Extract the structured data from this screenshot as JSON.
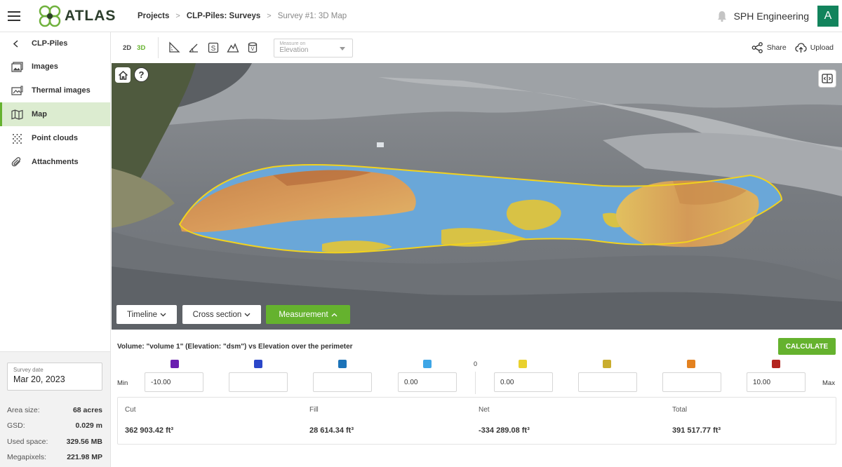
{
  "app": {
    "name": "ATLAS"
  },
  "breadcrumb": [
    {
      "label": "Projects"
    },
    {
      "label": "CLP-Piles: Surveys"
    },
    {
      "label": "Survey #1: 3D Map"
    }
  ],
  "header": {
    "org_name": "SPH Engineering",
    "avatar_letter": "A"
  },
  "sidebar": {
    "back_label": "CLP-Piles",
    "items": [
      {
        "label": "Images",
        "icon": "images-icon"
      },
      {
        "label": "Thermal images",
        "icon": "thermal-images-icon"
      },
      {
        "label": "Map",
        "icon": "map-icon",
        "active": true
      },
      {
        "label": "Point clouds",
        "icon": "point-clouds-icon"
      },
      {
        "label": "Attachments",
        "icon": "paperclip-icon"
      }
    ],
    "survey_date": {
      "label": "Survey date",
      "value": "Mar 20, 2023"
    },
    "stats": [
      {
        "key": "Area size:",
        "value": "68 acres"
      },
      {
        "key": "GSD:",
        "value": "0.029 m"
      },
      {
        "key": "Used space:",
        "value": "329.56 MB"
      },
      {
        "key": "Megapixels:",
        "value": "221.98 MP"
      }
    ]
  },
  "toolbar": {
    "mode_2d": "2D",
    "mode_3d": "3D",
    "active_mode": "3D",
    "measure_label": "Measure on",
    "measure_value": "Elevation",
    "share_label": "Share",
    "upload_label": "Upload"
  },
  "map": {
    "help_glyph": "?",
    "timeline_label": "Timeline",
    "cross_section_label": "Cross section",
    "measurement_label": "Measurement"
  },
  "volume": {
    "title": "Volume: \"volume 1\" (Elevation: \"dsm\") vs Elevation over the perimeter",
    "calculate_label": "CALCULATE",
    "zero_label": "0",
    "min_label": "Min",
    "max_label": "Max",
    "swatch_colors": [
      "#6a1fb0",
      "#2b47c9",
      "#1c73b8",
      "#3ea6e6",
      "#e9d12e",
      "#c9ad2e",
      "#e3811f",
      "#b3241f"
    ],
    "inputs": [
      "-10.00",
      "",
      "",
      "0.00",
      "0.00",
      "",
      "",
      "10.00"
    ],
    "results": [
      {
        "label": "Cut",
        "value": "362 903.42 ft³"
      },
      {
        "label": "Fill",
        "value": "28 614.34 ft³"
      },
      {
        "label": "Net",
        "value": "-334 289.08 ft³"
      },
      {
        "label": "Total",
        "value": "391 517.77 ft³"
      }
    ]
  },
  "colors": {
    "accent": "#65b22e",
    "avatar_bg": "#12835c",
    "active_bg": "#dcecd0"
  }
}
